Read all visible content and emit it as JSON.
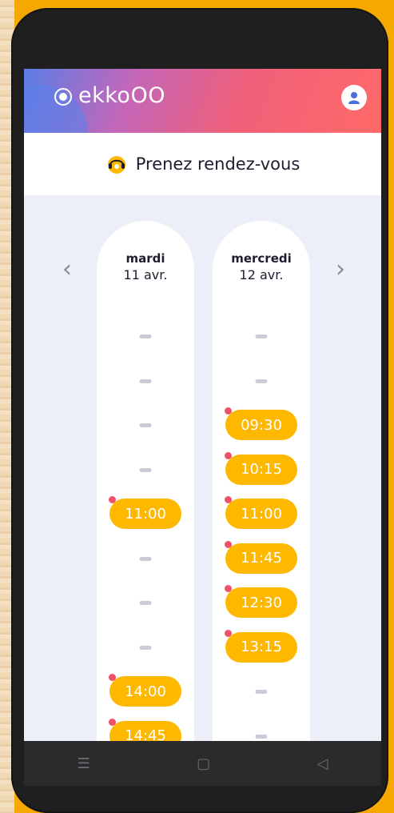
{
  "app": {
    "logo_text": "ekkoOO",
    "page_title": "Prenez rendez-vous"
  },
  "colors": {
    "accent": "#ffb800",
    "slot_marker": "#f0506a",
    "header_start": "#5b7ee6",
    "header_end": "#ff6a68"
  },
  "days": [
    {
      "name": "mardi",
      "date": "11 avr.",
      "slots": [
        "",
        "",
        "",
        "",
        "11:00",
        "",
        "",
        "",
        "14:00",
        "14:45"
      ]
    },
    {
      "name": "mercredi",
      "date": "12 avr.",
      "slots": [
        "",
        "",
        "09:30",
        "10:15",
        "11:00",
        "11:45",
        "12:30",
        "13:15",
        "",
        ""
      ]
    }
  ],
  "navigation": {
    "prev": "‹",
    "next": "›"
  },
  "system_nav": {
    "menu": "☰",
    "home": "▢",
    "back": "◁"
  }
}
